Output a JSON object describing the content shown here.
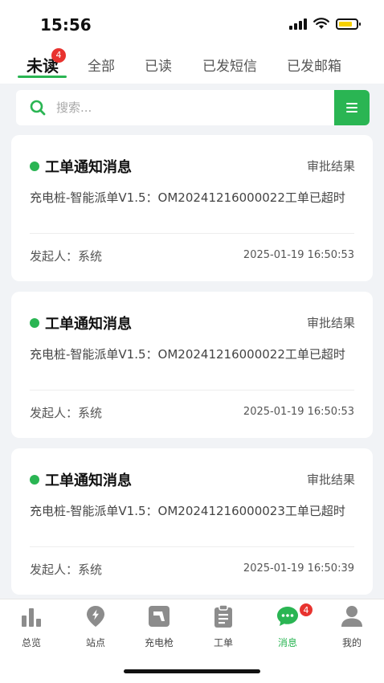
{
  "status_bar": {
    "time": "15:56",
    "battery_level": 0.8
  },
  "tabs": [
    {
      "label": "未读",
      "active": true,
      "badge": "4"
    },
    {
      "label": "全部"
    },
    {
      "label": "已读"
    },
    {
      "label": "已发短信"
    },
    {
      "label": "已发邮箱"
    }
  ],
  "search": {
    "placeholder": "搜索..."
  },
  "colors": {
    "accent": "#2ab553",
    "badge": "#e8332f"
  },
  "messages": [
    {
      "title": "工单通知消息",
      "tag": "审批结果",
      "content": "充电桩-智能派单V1.5：OM20241216000022工单已超时",
      "sender": "发起人：系统",
      "time": "2025-01-19 16:50:53"
    },
    {
      "title": "工单通知消息",
      "tag": "审批结果",
      "content": "充电桩-智能派单V1.5：OM20241216000022工单已超时",
      "sender": "发起人：系统",
      "time": "2025-01-19 16:50:53"
    },
    {
      "title": "工单通知消息",
      "tag": "审批结果",
      "content": "充电桩-智能派单V1.5：OM20241216000023工单已超时",
      "sender": "发起人：系统",
      "time": "2025-01-19 16:50:39"
    }
  ],
  "bottom_nav": [
    {
      "label": "总览",
      "icon": "bar-chart-icon"
    },
    {
      "label": "站点",
      "icon": "location-pin-icon"
    },
    {
      "label": "充电枪",
      "icon": "charging-gun-icon"
    },
    {
      "label": "工单",
      "icon": "clipboard-icon"
    },
    {
      "label": "消息",
      "icon": "chat-icon",
      "active": true,
      "badge": "4"
    },
    {
      "label": "我的",
      "icon": "user-icon"
    }
  ]
}
